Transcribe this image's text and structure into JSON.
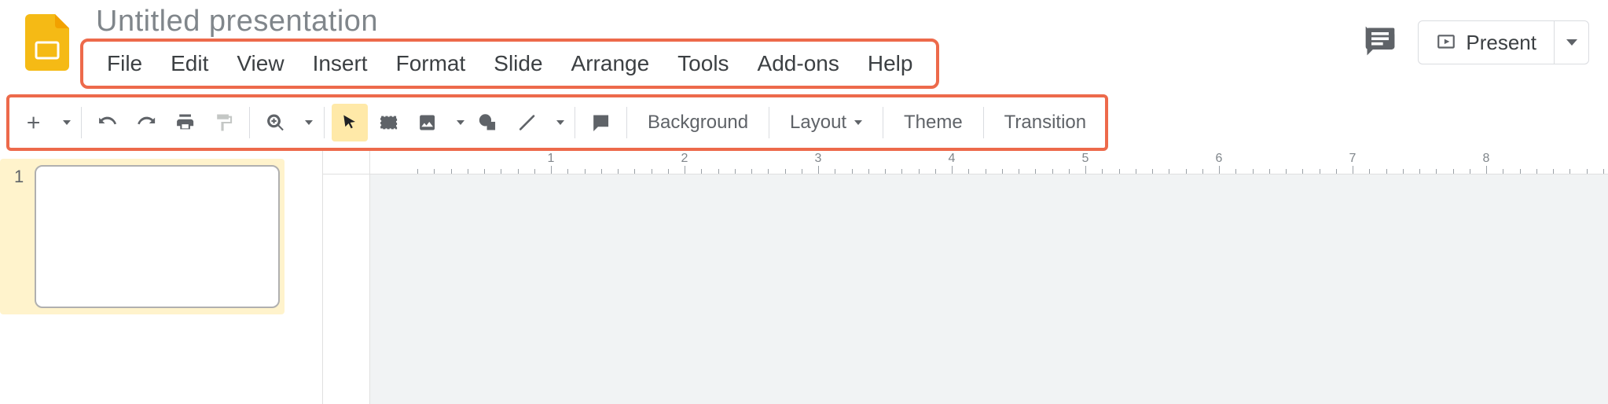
{
  "header": {
    "document_title": "Untitled presentation",
    "present_label": "Present"
  },
  "menubar": {
    "items": [
      "File",
      "Edit",
      "View",
      "Insert",
      "Format",
      "Slide",
      "Arrange",
      "Tools",
      "Add-ons",
      "Help"
    ]
  },
  "toolbar": {
    "background_label": "Background",
    "layout_label": "Layout",
    "theme_label": "Theme",
    "transition_label": "Transition"
  },
  "filmstrip": {
    "slides": [
      {
        "number": "1"
      }
    ]
  },
  "ruler": {
    "labels": [
      "1",
      "2",
      "3",
      "4",
      "5",
      "6",
      "7",
      "8"
    ]
  }
}
